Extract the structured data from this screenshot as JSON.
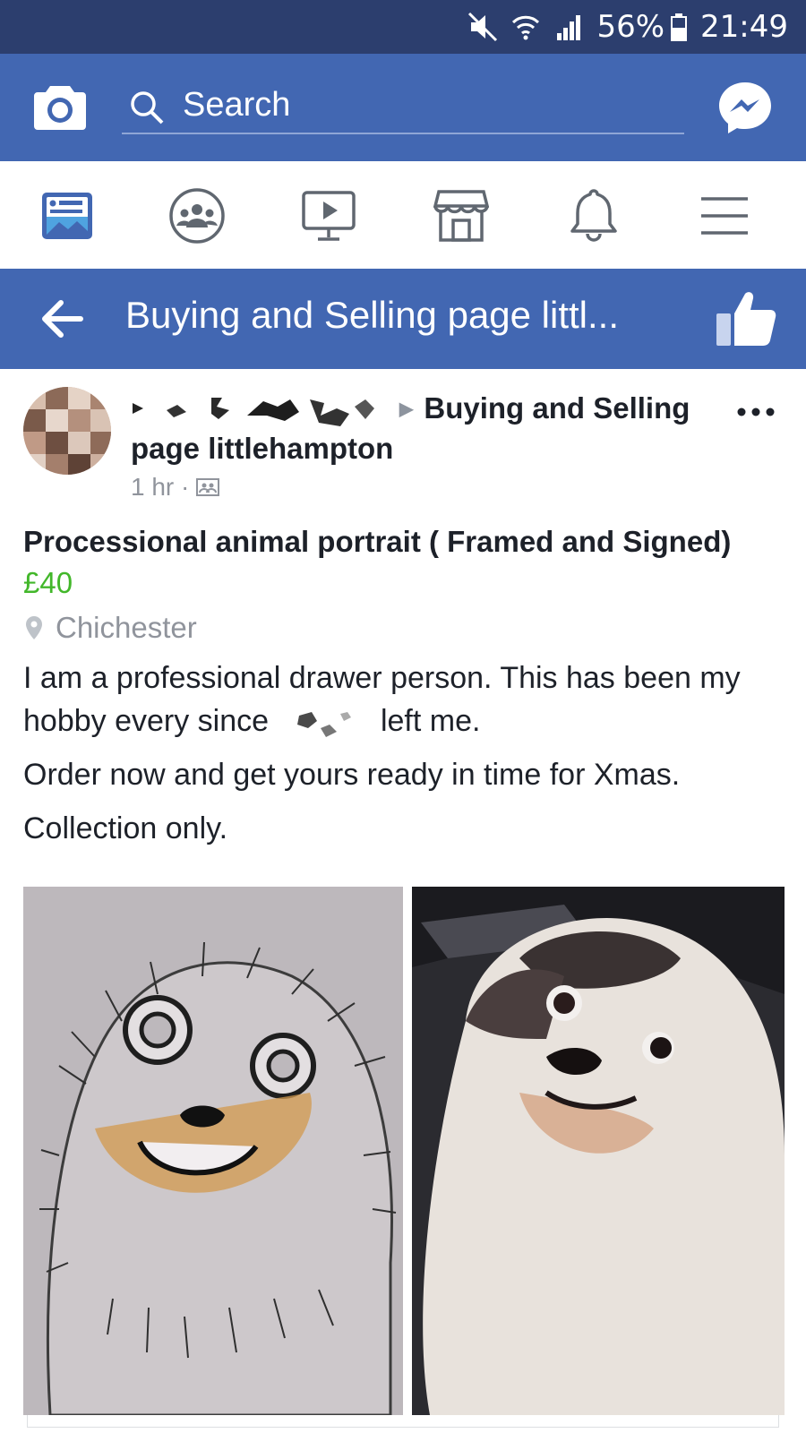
{
  "status_bar": {
    "battery": "56%",
    "time": "21:49"
  },
  "search": {
    "placeholder": "Search"
  },
  "group": {
    "title": "Buying and Selling page littl..."
  },
  "post": {
    "group_name_part1": "Buying and Selling",
    "group_name_part2": "page littlehampton",
    "time": "1 hr ·",
    "listing_title": "Processional animal portrait ( Framed and Signed)",
    "price": "£40",
    "location": "Chichester",
    "body_line1": "I am a professional drawer person. This has been my",
    "body_line2a": "hobby every since",
    "body_line2b": "left me.",
    "body_line3": "Order now and get yours ready in time for Xmas.",
    "body_line4": "Collection only."
  },
  "colors": {
    "status_bar": "#2c3e6e",
    "brand_blue": "#4267b2",
    "price_green": "#42b72a",
    "muted_gray": "#90949c"
  },
  "icons": [
    "camera-icon",
    "search-icon",
    "messenger-icon",
    "news-feed-icon",
    "groups-icon",
    "watch-icon",
    "marketplace-icon",
    "notifications-icon",
    "menu-icon",
    "back-arrow-icon",
    "like-icon",
    "more-icon",
    "location-pin-icon"
  ]
}
